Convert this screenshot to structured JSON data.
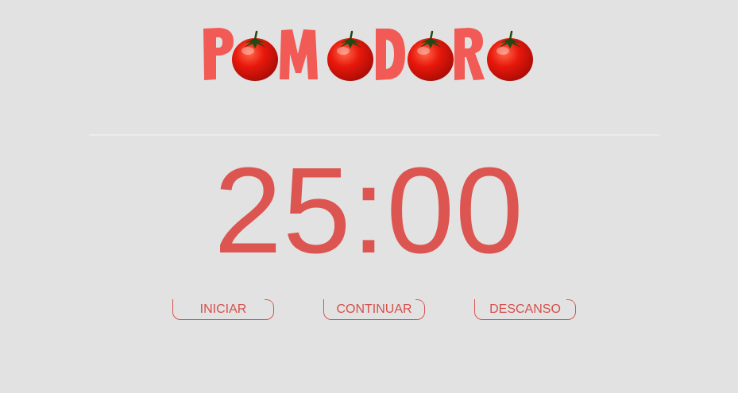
{
  "app": {
    "logo_text": "POMODORO"
  },
  "timer": {
    "display": "25:00"
  },
  "controls": {
    "start_label": "INICIAR",
    "continue_label": "CONTINUAR",
    "break_label": "DESCANSO"
  },
  "colors": {
    "background": "#e2e2e2",
    "accent": "#dc5550",
    "logo_letters": "#f15a55",
    "tomato": "#e41b0e"
  },
  "icons": {
    "logo_o_glyph": "tomato-icon"
  }
}
